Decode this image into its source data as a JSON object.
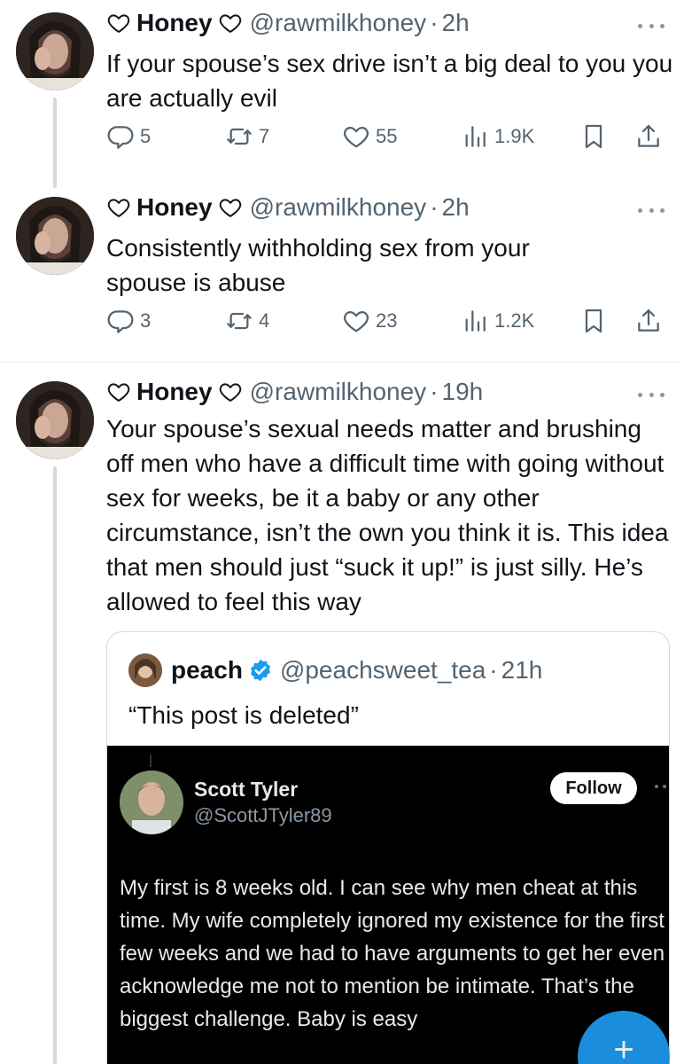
{
  "tweets": [
    {
      "name": "Honey",
      "handle": "@rawmilkhoney",
      "dot": "·",
      "time": "2h",
      "text": "If your spouse’s sex drive isn’t a big deal to you you are actually evil",
      "replies": "5",
      "retweets": "7",
      "likes": "55",
      "views": "1.9K"
    },
    {
      "name": "Honey",
      "handle": "@rawmilkhoney",
      "dot": "·",
      "time": "2h",
      "text": "Consistently withholding sex from your spouse is abuse",
      "replies": "3",
      "retweets": "4",
      "likes": "23",
      "views": "1.2K"
    },
    {
      "name": "Honey",
      "handle": "@rawmilkhoney",
      "dot": "·",
      "time": "19h",
      "text": "Your spouse’s sexual needs matter and brushing off men who have a difficult time with going without sex for weeks, be it a baby or any other circumstance, isn’t the own you think it is. This idea that men should just “suck it up!” is just silly. He’s allowed to feel this way"
    }
  ],
  "quote": {
    "name": "peach",
    "handle": "@peachsweet_tea",
    "dot": "·",
    "time": "21h",
    "text": "“This post is deleted”",
    "media": {
      "name": "Scott Tyler",
      "handle": "@ScottJTyler89",
      "follow_label": "Follow",
      "text": "My first is 8 weeks old. I can see why men cheat at this time. My wife completely ignored my existence for the first few weeks and we had to have arguments to get her even acknowledge me not to mention be intimate. That’s the biggest challenge. Baby is easy"
    }
  },
  "fab": {
    "label": "+"
  },
  "icons": {
    "reply": "reply-icon",
    "retweet": "retweet-icon",
    "like": "like-icon",
    "views": "views-icon",
    "bookmark": "bookmark-icon",
    "share": "share-icon",
    "heart_emoji": "heart-outline-icon",
    "verified": "verified-badge-icon"
  },
  "colors": {
    "text": "#0f1419",
    "secondary": "#536471",
    "accent": "#1d9bf0",
    "thread_line": "#cfd9de"
  }
}
